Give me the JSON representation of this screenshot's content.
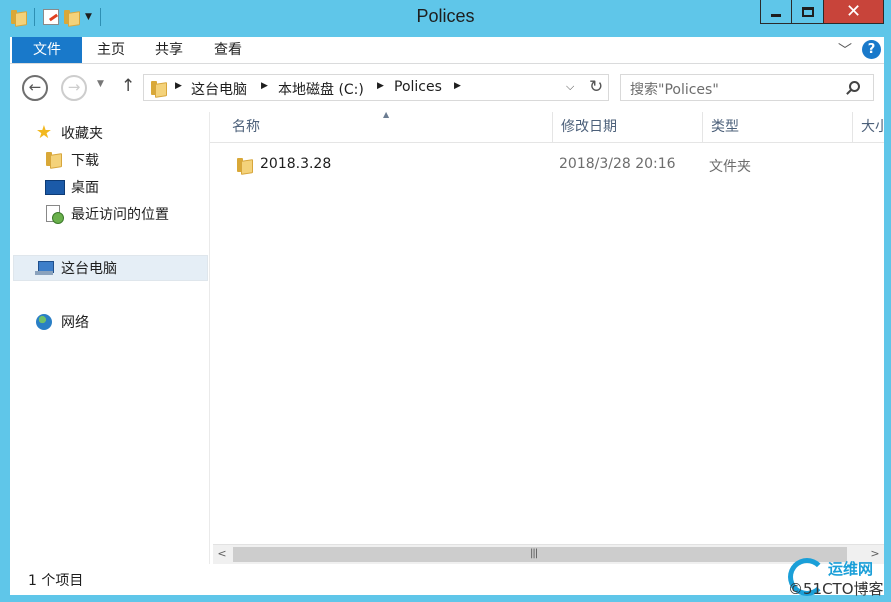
{
  "window": {
    "title": "Polices",
    "close_glyph": "✕"
  },
  "ribbon": {
    "tabs": [
      "文件",
      "主页",
      "共享",
      "查看"
    ],
    "help_label": "?"
  },
  "nav": {
    "back_glyph": "←",
    "forward_glyph": "→",
    "up_glyph": "↑",
    "breadcrumbs": [
      "这台电脑",
      "本地磁盘 (C:)",
      "Polices"
    ],
    "search_placeholder": "搜索\"Polices\""
  },
  "sidebar": {
    "items": [
      {
        "label": "收藏夹",
        "icon": "star-icon"
      },
      {
        "label": "下载",
        "icon": "folder-icon"
      },
      {
        "label": "桌面",
        "icon": "desktop-icon"
      },
      {
        "label": "最近访问的位置",
        "icon": "recent-places-icon"
      },
      {
        "label": "这台电脑",
        "icon": "computer-icon",
        "selected": true
      },
      {
        "label": "网络",
        "icon": "network-icon"
      }
    ]
  },
  "columns": [
    "名称",
    "修改日期",
    "类型",
    "大小"
  ],
  "files": [
    {
      "name": "2018.3.28",
      "modified": "2018/3/28 20:16",
      "type": "文件夹"
    }
  ],
  "status": {
    "item_count": "1 个项目"
  },
  "watermark": {
    "cn": "运维网",
    "en": "©51CTO博客"
  },
  "colors": {
    "titlebar": "#5fc6e9",
    "file_tab": "#1979ca",
    "close_button": "#c8443a",
    "selection": "#e5eef6"
  }
}
